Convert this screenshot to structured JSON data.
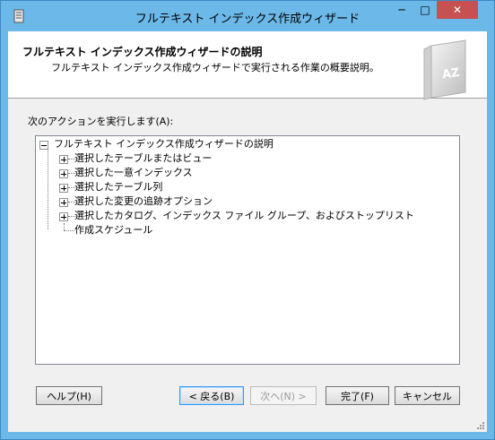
{
  "window": {
    "title": "フルテキスト インデックス作成ウィザード",
    "controls": {
      "minimize": "─",
      "maximize": "□",
      "close": "✕"
    }
  },
  "header": {
    "title": "フルテキスト インデックス作成ウィザードの説明",
    "subtitle": "フルテキスト インデックス作成ウィザードで実行される作業の概要説明。",
    "graphic_text": "AZ"
  },
  "main": {
    "actions_label": "次のアクションを実行します(A):",
    "tree": {
      "root": "フルテキスト インデックス作成ウィザードの説明",
      "items": [
        {
          "label": "選択したテーブルまたはビュー",
          "expandable": true
        },
        {
          "label": "選択した一意インデックス",
          "expandable": true
        },
        {
          "label": "選択したテーブル列",
          "expandable": true
        },
        {
          "label": "選択した変更の追跡オプション",
          "expandable": true
        },
        {
          "label": "選択したカタログ、インデックス ファイル グループ、およびストップリスト",
          "expandable": true
        },
        {
          "label": "作成スケジュール",
          "expandable": false
        }
      ]
    }
  },
  "buttons": {
    "help": "ヘルプ(H)",
    "back": "< 戻る(B)",
    "next": "次へ(N) >",
    "finish": "完了(F)",
    "cancel": "キャンセル"
  },
  "colors": {
    "titlebar": "#6cb8e8",
    "close_button": "#c75050",
    "dialog_body": "#f0f0f0"
  }
}
